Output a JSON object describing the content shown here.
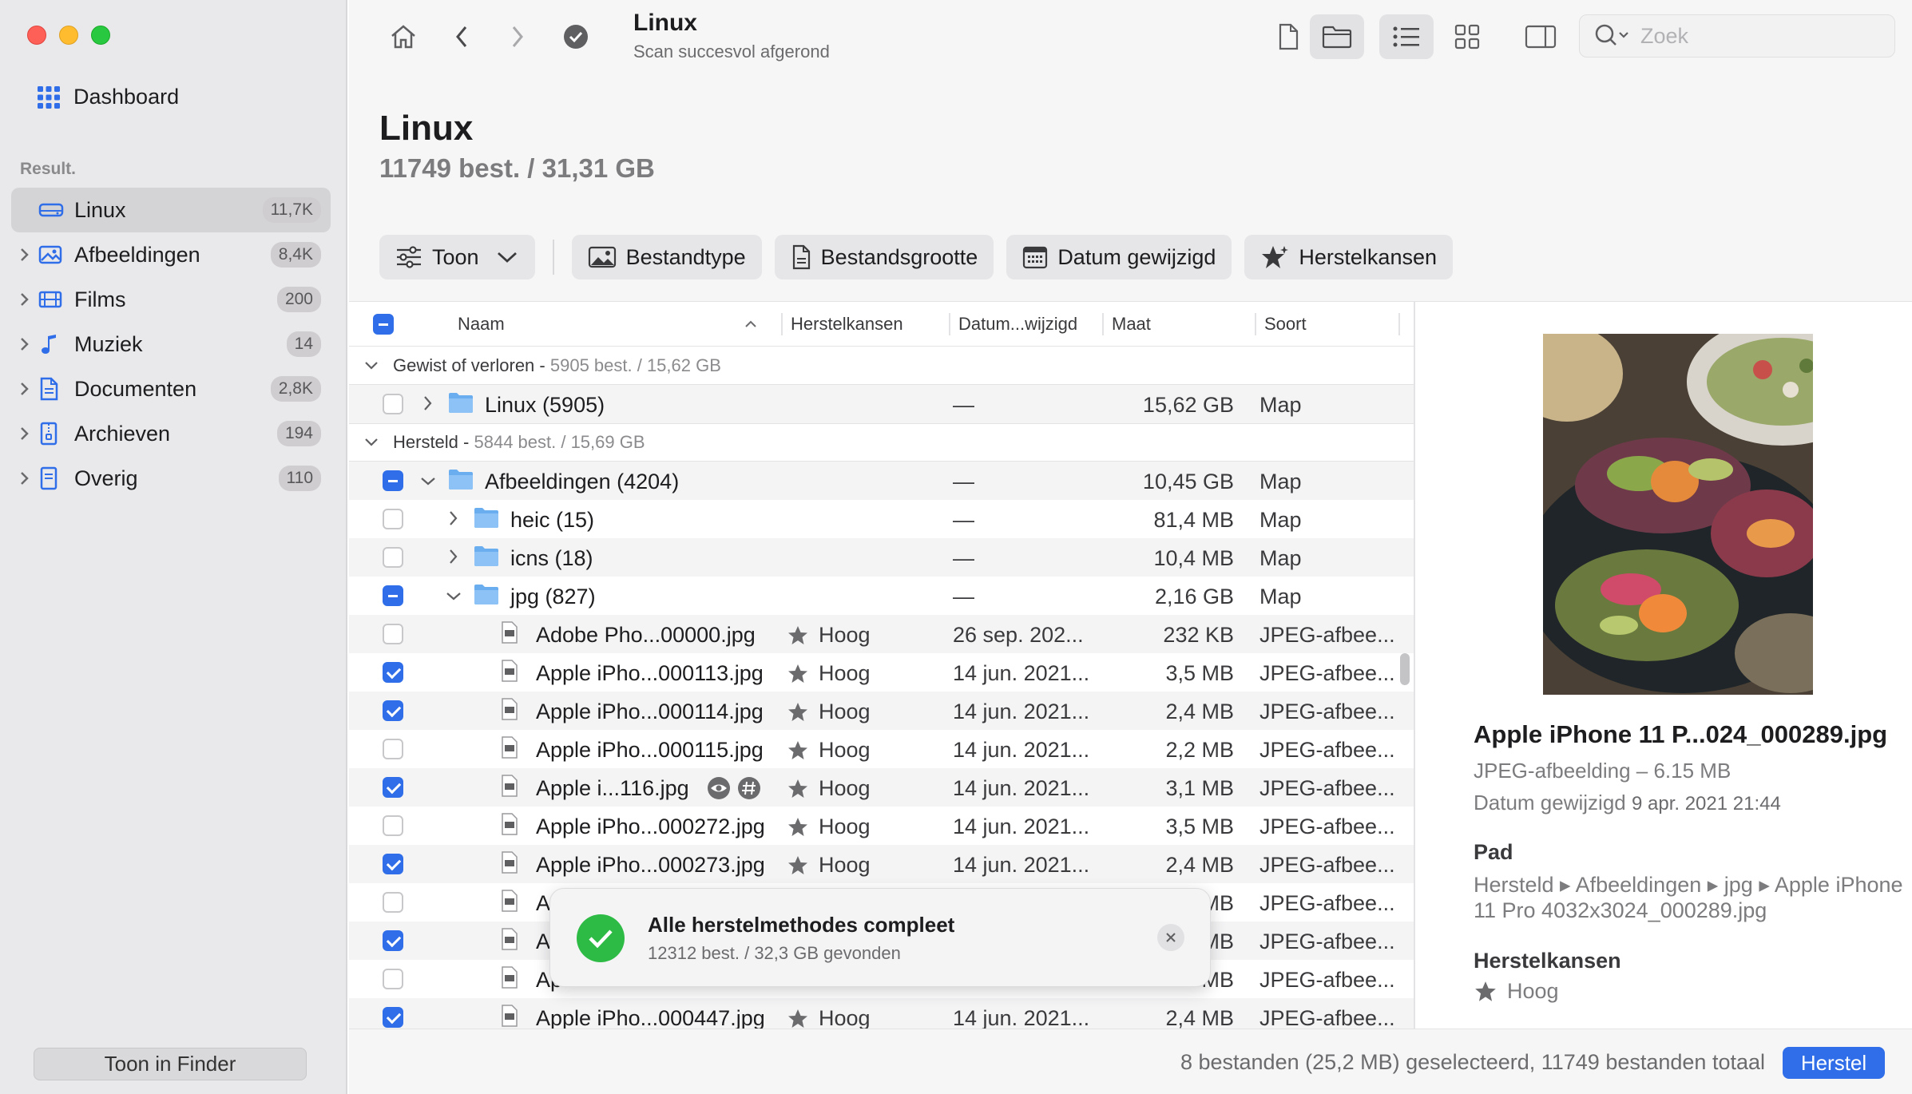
{
  "sidebar": {
    "dashboard_label": "Dashboard",
    "section_label": "Result.",
    "items": [
      {
        "label": "Linux",
        "count": "11,7K",
        "icon": "drive-icon"
      },
      {
        "label": "Afbeeldingen",
        "count": "8,4K",
        "icon": "image-icon"
      },
      {
        "label": "Films",
        "count": "200",
        "icon": "film-icon"
      },
      {
        "label": "Muziek",
        "count": "14",
        "icon": "music-icon"
      },
      {
        "label": "Documenten",
        "count": "2,8K",
        "icon": "document-icon"
      },
      {
        "label": "Archieven",
        "count": "194",
        "icon": "archive-icon"
      },
      {
        "label": "Overig",
        "count": "110",
        "icon": "other-icon"
      }
    ],
    "finder_button": "Toon in Finder"
  },
  "toolbar": {
    "title": "Linux",
    "subtitle": "Scan succesvol afgerond",
    "search_placeholder": "Zoek"
  },
  "header": {
    "title": "Linux",
    "summary": "11749 best. / 31,31 GB",
    "filters": {
      "show": "Toon",
      "filetype": "Bestandtype",
      "filesize": "Bestandsgrootte",
      "date": "Datum gewijzigd",
      "recovery": "Herstelkansen"
    }
  },
  "table": {
    "columns": {
      "name": "Naam",
      "recovery": "Herstelkansen",
      "date": "Datum...wijzigd",
      "size": "Maat",
      "kind": "Soort"
    },
    "group_lost": {
      "label": "Gewist of verloren",
      "sep": " - ",
      "summary": "5905 best. / 15,62 GB"
    },
    "row_linux": {
      "name": "Linux (5905)",
      "date": "—",
      "size": "15,62 GB",
      "kind": "Map"
    },
    "group_recovered": {
      "label": "Hersteld",
      "sep": " - ",
      "summary": "5844 best. / 15,69 GB"
    },
    "folders": [
      {
        "name": "Afbeeldingen (4204)",
        "date": "—",
        "size": "10,45 GB",
        "kind": "Map"
      },
      {
        "name": "heic (15)",
        "date": "—",
        "size": "81,4 MB",
        "kind": "Map"
      },
      {
        "name": "icns (18)",
        "date": "—",
        "size": "10,4 MB",
        "kind": "Map"
      },
      {
        "name": "jpg (827)",
        "date": "—",
        "size": "2,16 GB",
        "kind": "Map"
      }
    ],
    "files": [
      {
        "name": "Adobe Pho...00000.jpg",
        "rec": "Hoog",
        "date": "26 sep. 202...",
        "size": "232 KB",
        "kind": "JPEG-afbee..."
      },
      {
        "name": "Apple iPho...000113.jpg",
        "rec": "Hoog",
        "date": "14 jun. 2021...",
        "size": "3,5 MB",
        "kind": "JPEG-afbee..."
      },
      {
        "name": "Apple iPho...000114.jpg",
        "rec": "Hoog",
        "date": "14 jun. 2021...",
        "size": "2,4 MB",
        "kind": "JPEG-afbee..."
      },
      {
        "name": "Apple iPho...000115.jpg",
        "rec": "Hoog",
        "date": "14 jun. 2021...",
        "size": "2,2 MB",
        "kind": "JPEG-afbee..."
      },
      {
        "name": "Apple i...116.jpg",
        "rec": "Hoog",
        "date": "14 jun. 2021...",
        "size": "3,1 MB",
        "kind": "JPEG-afbee..."
      },
      {
        "name": "Apple iPho...000272.jpg",
        "rec": "Hoog",
        "date": "14 jun. 2021...",
        "size": "3,5 MB",
        "kind": "JPEG-afbee..."
      },
      {
        "name": "Apple iPho...000273.jpg",
        "rec": "Hoog",
        "date": "14 jun. 2021...",
        "size": "2,4 MB",
        "kind": "JPEG-afbee..."
      },
      {
        "name": "A",
        "rec": "",
        "date": "",
        "size": "MB",
        "kind": "JPEG-afbee..."
      },
      {
        "name": "A",
        "rec": "",
        "date": "",
        "size": "MB",
        "kind": "JPEG-afbee..."
      },
      {
        "name": "Ap",
        "rec": "",
        "date": "",
        "size": "MB",
        "kind": "JPEG-afbee..."
      },
      {
        "name": "Apple iPho...000447.jpg",
        "rec": "Hoog",
        "date": "14 jun. 2021...",
        "size": "2,4 MB",
        "kind": "JPEG-afbee..."
      }
    ]
  },
  "toast": {
    "title": "Alle herstelmethodes compleet",
    "subtitle": "12312 best. / 32,3 GB gevonden"
  },
  "preview": {
    "name": "Apple iPhone 11 P...024_000289.jpg",
    "type": "JPEG-afbeelding – 6.15 MB",
    "date_label": "Datum gewijzigd",
    "date_value": "9 apr. 2021 21:44",
    "path_heading": "Pad",
    "path": "Hersteld ▸ Afbeeldingen ▸ jpg ▸ Apple iPhone 11 Pro 4032x3024_000289.jpg",
    "recovery_heading": "Herstelkansen",
    "recovery_value": "Hoog"
  },
  "footer": {
    "status": "8 bestanden (25,2 MB) geselecteerd, 11749 bestanden totaal",
    "recover_button": "Herstel"
  },
  "colors": {
    "accent": "#2f6ee8",
    "success": "#2dbb45",
    "folder": "#6aaef0"
  }
}
